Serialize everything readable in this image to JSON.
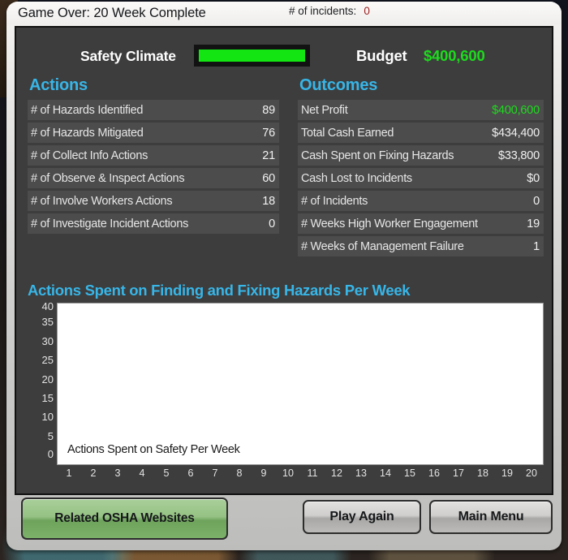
{
  "window": {
    "title": "Game Over: 20 Week Complete",
    "incidents_label": "# of incidents:",
    "incidents_value": "0",
    "incidents_color": "#9a1d1d"
  },
  "header": {
    "safety_climate_label": "Safety Climate",
    "safety_climate_percent": 100,
    "safety_climate_color": "#12e512",
    "budget_label": "Budget",
    "budget_value": "$400,600",
    "budget_color": "#1ddb1d"
  },
  "actions": {
    "heading": "Actions",
    "rows": [
      {
        "label": "# of Hazards Identified",
        "value": "89"
      },
      {
        "label": "# of Hazards Mitigated",
        "value": "76"
      },
      {
        "label": "# of Collect Info Actions",
        "value": "21"
      },
      {
        "label": "# of Observe & Inspect Actions",
        "value": "60"
      },
      {
        "label": "# of Involve Workers Actions",
        "value": "18"
      },
      {
        "label": "# of Investigate Incident Actions",
        "value": "0"
      }
    ]
  },
  "outcomes": {
    "heading": "Outcomes",
    "rows": [
      {
        "label": "Net Profit",
        "value": "$400,600",
        "positive": true
      },
      {
        "label": "Total Cash Earned",
        "value": "$434,400",
        "positive": false
      },
      {
        "label": "Cash Spent on Fixing Hazards",
        "value": "$33,800",
        "positive": false
      },
      {
        "label": "Cash Lost to Incidents",
        "value": "$0",
        "positive": false
      },
      {
        "label": "# of Incidents",
        "value": "0",
        "positive": false
      },
      {
        "label": "# Weeks High Worker Engagement",
        "value": "19",
        "positive": false
      },
      {
        "label": "# Weeks of Management Failure",
        "value": "1",
        "positive": false
      }
    ]
  },
  "chart_data": {
    "type": "line",
    "title": "Actions Spent on Finding and Fixing Hazards Per Week",
    "annotation": "Actions Spent on Safety Per Week",
    "xlabel": "",
    "ylabel": "",
    "grid": false,
    "legend": "none",
    "ylim": [
      0,
      40
    ],
    "y_ticks": [
      "40",
      "35",
      "30",
      "25",
      "20",
      "15",
      "10",
      "5",
      "0"
    ],
    "xlim": [
      1,
      20
    ],
    "categories": [
      "1",
      "2",
      "3",
      "4",
      "5",
      "6",
      "7",
      "8",
      "9",
      "10",
      "11",
      "12",
      "13",
      "14",
      "15",
      "16",
      "17",
      "18",
      "19",
      "20"
    ],
    "series": [
      {
        "name": "Actions Spent on Safety Per Week",
        "values": []
      }
    ],
    "plot_background": "#ffffff",
    "note": "Plot area is rendered blank; no data points are drawn in this screenshot."
  },
  "footer": {
    "osha_label": "Related OSHA Websites",
    "play_again_label": "Play Again",
    "main_menu_label": "Main Menu"
  }
}
